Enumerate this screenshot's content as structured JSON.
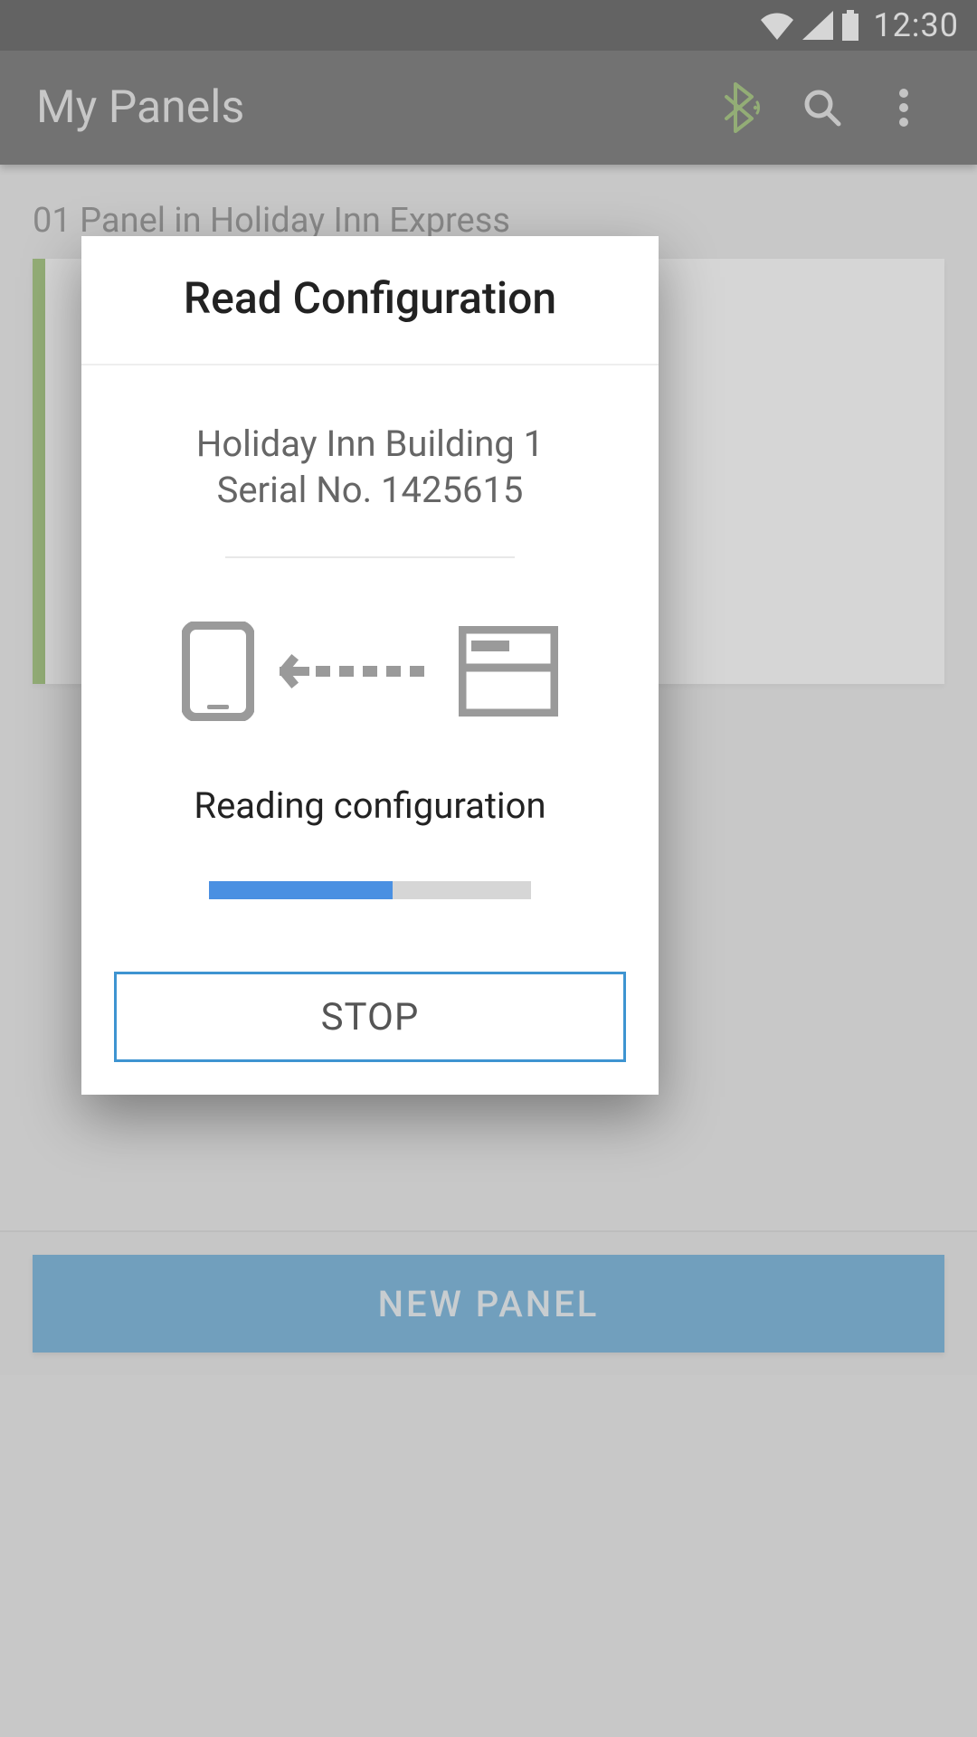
{
  "status_bar": {
    "time": "12:30"
  },
  "app_bar": {
    "title": "My Panels"
  },
  "section": {
    "label": "01 Panel in Holiday Inn Express"
  },
  "bottom": {
    "new_panel_label": "NEW PANEL"
  },
  "dialog": {
    "title": "Read Configuration",
    "device_name": "Holiday Inn Building 1",
    "serial_label": "Serial No. 1425615",
    "status_text": "Reading configuration",
    "progress_percent": 57,
    "stop_label": "STOP"
  },
  "colors": {
    "accent_green": "#6BA52B",
    "primary_blue": "#2086C7",
    "progress_blue": "#4A90E2",
    "outline_blue": "#3E94D1"
  }
}
